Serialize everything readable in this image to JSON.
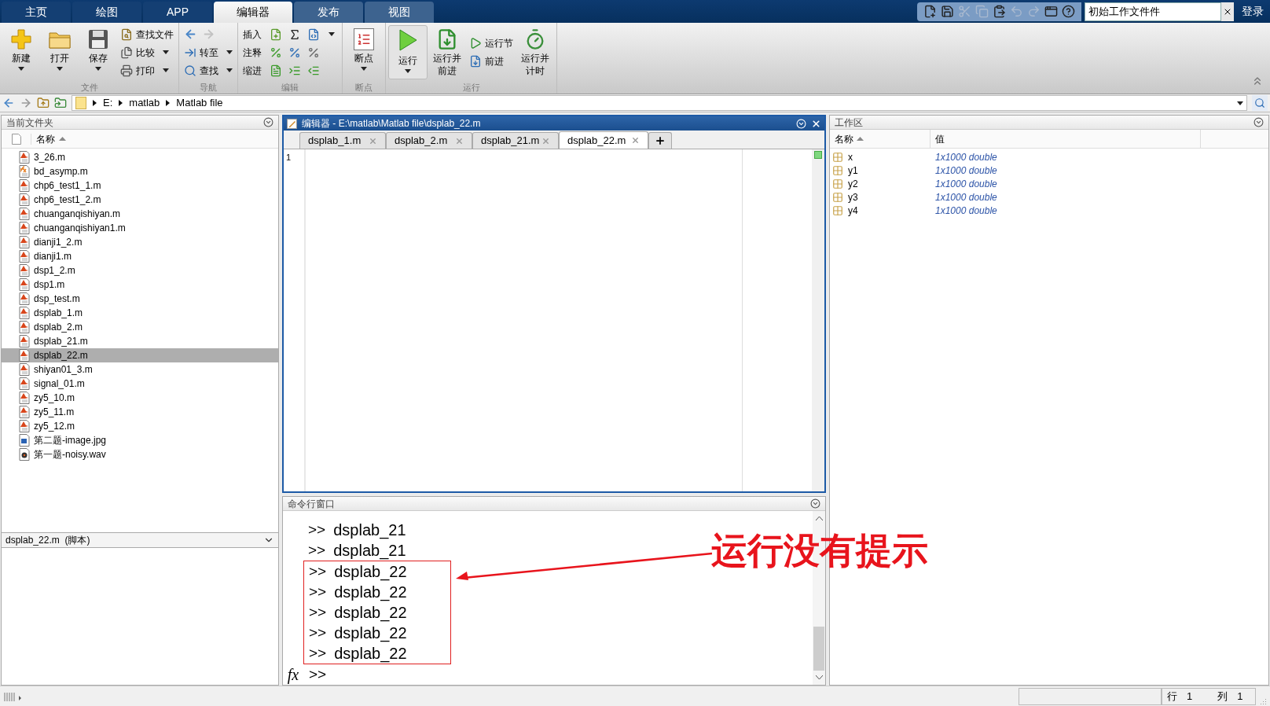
{
  "top_tabs": [
    {
      "label": "主页",
      "selected": false
    },
    {
      "label": "绘图",
      "selected": false
    },
    {
      "label": "APP",
      "selected": false
    },
    {
      "label": "编辑器",
      "selected": true
    },
    {
      "label": "发布",
      "selected": false
    },
    {
      "label": "视图",
      "selected": false
    }
  ],
  "quick_access": {
    "buttons": [
      {
        "disabled": false
      },
      {
        "disabled": false
      },
      {
        "disabled": true
      },
      {
        "disabled": true
      },
      {
        "disabled": false
      },
      {
        "disabled": true
      },
      {
        "disabled": true
      },
      {
        "disabled": false
      },
      {
        "disabled": false
      }
    ],
    "search_value": "初始工作文件件",
    "login": "登录"
  },
  "ribbon": {
    "groups": [
      {
        "label": "文件",
        "columns": [
          [
            {
              "kind": "large",
              "label": "新建",
              "dropdown": true
            }
          ],
          [
            {
              "kind": "large",
              "label": "打开",
              "dropdown": true
            }
          ],
          [
            {
              "kind": "large",
              "label": "保存",
              "dropdown": true
            }
          ],
          [
            {
              "kind": "small",
              "label": "查找文件",
              "dropdown": false
            },
            {
              "kind": "small",
              "label": "比较",
              "dropdown": true
            },
            {
              "kind": "small",
              "label": "打印",
              "dropdown": true
            }
          ]
        ]
      },
      {
        "label": "导航",
        "columns": [
          [
            {
              "kind": "arrows"
            },
            {
              "kind": "small",
              "label": "转至",
              "dropdown": true
            },
            {
              "kind": "small",
              "label": "查找",
              "dropdown": true
            }
          ]
        ]
      },
      {
        "label": "编辑",
        "columns": [
          [
            {
              "kind": "tools",
              "label": "插入",
              "dropdown": true
            },
            {
              "kind": "tools",
              "label": "注释",
              "dropdown": false
            },
            {
              "kind": "tools",
              "label": "缩进",
              "dropdown": false
            }
          ]
        ]
      },
      {
        "label": "断点",
        "columns": [
          [
            {
              "kind": "large",
              "label": "断点",
              "dropdown": true
            }
          ]
        ]
      },
      {
        "label": "运行",
        "columns": [
          [
            {
              "kind": "run",
              "label": "运行",
              "dropdown": true
            }
          ],
          [
            {
              "kind": "large",
              "label": "运行并前进",
              "dropdown": false
            }
          ],
          [
            {
              "kind": "small",
              "label": "运行节",
              "dropdown": false
            },
            {
              "kind": "small",
              "label": "前进",
              "dropdown": false
            }
          ],
          [
            {
              "kind": "large",
              "label": "运行并计时",
              "dropdown": false
            }
          ]
        ]
      }
    ]
  },
  "address_bar": {
    "path": [
      "E:",
      "matlab",
      "Matlab file"
    ]
  },
  "current_folder": {
    "title": "当前文件夹",
    "column": {
      "label": "名称",
      "sorted": true
    },
    "files": [
      {
        "name": "3_26.m",
        "kind": "script",
        "selected": false
      },
      {
        "name": "bd_asymp.m",
        "kind": "function",
        "selected": false
      },
      {
        "name": "chp6_test1_1.m",
        "kind": "script",
        "selected": false
      },
      {
        "name": "chp6_test1_2.m",
        "kind": "script",
        "selected": false
      },
      {
        "name": "chuanganqishiyan.m",
        "kind": "script",
        "selected": false
      },
      {
        "name": "chuanganqishiyan1.m",
        "kind": "script",
        "selected": false
      },
      {
        "name": "dianji1_2.m",
        "kind": "script",
        "selected": false
      },
      {
        "name": "dianji1.m",
        "kind": "script",
        "selected": false
      },
      {
        "name": "dsp1_2.m",
        "kind": "script",
        "selected": false
      },
      {
        "name": "dsp1.m",
        "kind": "script",
        "selected": false
      },
      {
        "name": "dsp_test.m",
        "kind": "script",
        "selected": false
      },
      {
        "name": "dsplab_1.m",
        "kind": "script",
        "selected": false
      },
      {
        "name": "dsplab_2.m",
        "kind": "script",
        "selected": false
      },
      {
        "name": "dsplab_21.m",
        "kind": "script",
        "selected": false
      },
      {
        "name": "dsplab_22.m",
        "kind": "script",
        "selected": true
      },
      {
        "name": "shiyan01_3.m",
        "kind": "script",
        "selected": false
      },
      {
        "name": "signal_01.m",
        "kind": "script",
        "selected": false
      },
      {
        "name": "zy5_10.m",
        "kind": "script",
        "selected": false
      },
      {
        "name": "zy5_11.m",
        "kind": "script",
        "selected": false
      },
      {
        "name": "zy5_12.m",
        "kind": "script",
        "selected": false
      },
      {
        "name": "第二题-image.jpg",
        "kind": "image",
        "selected": false
      },
      {
        "name": "第一题-noisy.wav",
        "kind": "audio",
        "selected": false
      }
    ],
    "details": "dsplab_22.m  (脚本)"
  },
  "editor": {
    "title": "编辑器 - E:\\matlab\\Matlab file\\dsplab_22.m",
    "tabs": [
      {
        "label": "dsplab_1.m",
        "selected": false
      },
      {
        "label": "dsplab_2.m",
        "selected": false
      },
      {
        "label": "dsplab_21.m",
        "selected": false
      },
      {
        "label": "dsplab_22.m",
        "selected": true
      }
    ],
    "line_numbers": [
      "1"
    ]
  },
  "command_window": {
    "title": "命令行窗口",
    "lines": [
      {
        "prompt": ">>",
        "command": "dsplab_21",
        "highlighted": false
      },
      {
        "prompt": ">>",
        "command": "dsplab_21",
        "highlighted": false
      },
      {
        "prompt": ">>",
        "command": "dsplab_22",
        "highlighted": true
      },
      {
        "prompt": ">>",
        "command": "dsplab_22",
        "highlighted": true
      },
      {
        "prompt": ">>",
        "command": "dsplab_22",
        "highlighted": true
      },
      {
        "prompt": ">>",
        "command": "dsplab_22",
        "highlighted": true
      },
      {
        "prompt": ">>",
        "command": "dsplab_22",
        "highlighted": true
      }
    ],
    "function_button": "fx",
    "prompt": ">>",
    "annotation": {
      "text": "运行没有提示"
    }
  },
  "workspace": {
    "title": "工作区",
    "columns": [
      {
        "label": "名称",
        "sorted": true
      },
      {
        "label": "值",
        "sorted": false
      }
    ],
    "rows": [
      {
        "name": "x",
        "value": "1x1000 double"
      },
      {
        "name": "y1",
        "value": "1x1000 double"
      },
      {
        "name": "y2",
        "value": "1x1000 double"
      },
      {
        "name": "y3",
        "value": "1x1000 double"
      },
      {
        "name": "y4",
        "value": "1x1000 double"
      }
    ]
  },
  "status_bar": {
    "row_label": "行",
    "row": "1",
    "col_label": "列",
    "col": "1"
  }
}
